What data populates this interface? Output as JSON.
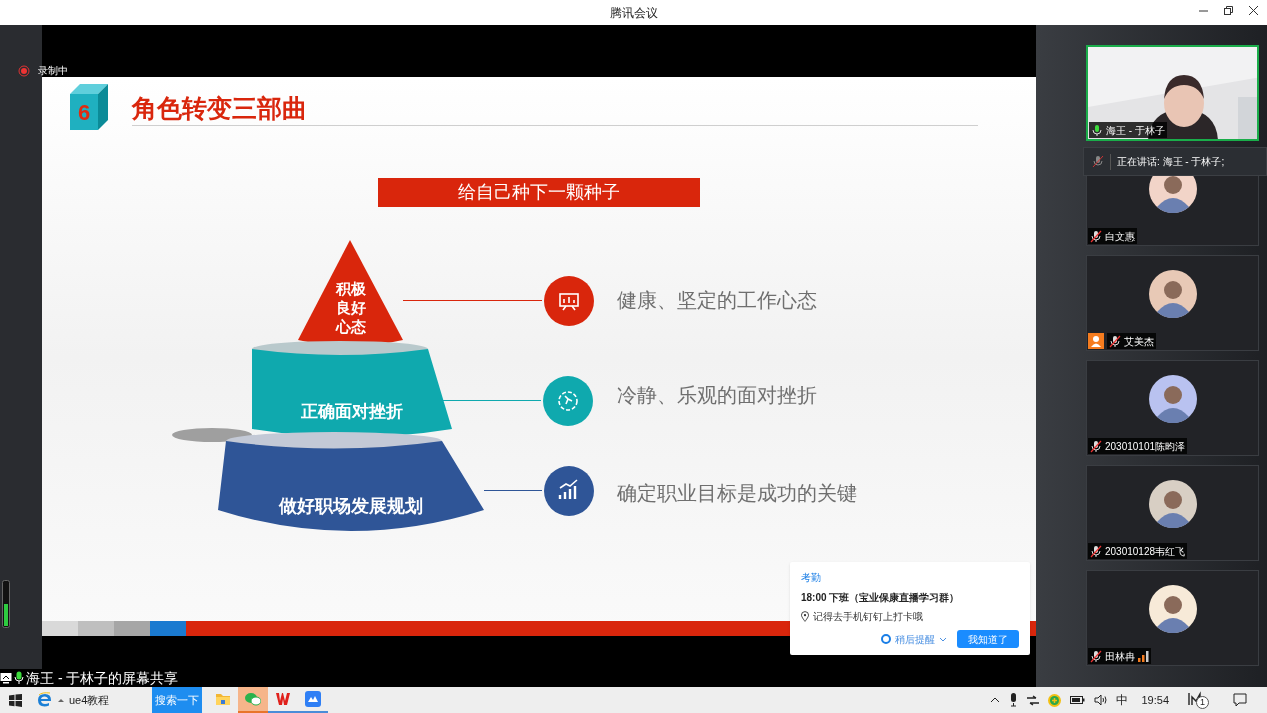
{
  "window": {
    "title": "腾讯会议"
  },
  "recording": {
    "label": "录制中"
  },
  "slide": {
    "number": "6",
    "title": "角色转变三部曲",
    "banner": "给自己种下一颗种子",
    "levels": [
      {
        "kind": "top",
        "label": "积极良好心态",
        "point": "健康、坚定的工作心态"
      },
      {
        "kind": "middle",
        "label": "正确面对挫折",
        "point": "冷静、乐观的面对挫折"
      },
      {
        "kind": "bottom",
        "label": "做好职场发展规划",
        "point": "确定职业目标是成功的关键"
      }
    ]
  },
  "participants": [
    {
      "kind": "video",
      "name": "海王 - 于林子",
      "muted": false,
      "speaking": true,
      "host_badge": false,
      "weak_signal": false
    },
    {
      "kind": "avatar",
      "name": "白文惠",
      "muted": true,
      "speaking": false,
      "host_badge": false,
      "weak_signal": false
    },
    {
      "kind": "avatar",
      "name": "艾美杰",
      "muted": true,
      "speaking": false,
      "host_badge": true,
      "weak_signal": false
    },
    {
      "kind": "avatar",
      "name": "203010101陈昀泽",
      "muted": true,
      "speaking": false,
      "host_badge": false,
      "weak_signal": false
    },
    {
      "kind": "avatar",
      "name": "203010128韦红飞",
      "muted": true,
      "speaking": false,
      "host_badge": false,
      "weak_signal": false
    },
    {
      "kind": "avatar",
      "name": "田林冉",
      "muted": true,
      "speaking": false,
      "host_badge": false,
      "weak_signal": true
    }
  ],
  "speaking_banner": {
    "text": "正在讲话: 海王 - 于林子;"
  },
  "notification": {
    "category": "考勤",
    "title": "18:00 下班（宝业保康直播学习群）",
    "location": "记得去手机钉钉上打卡哦",
    "snooze": "稍后提醒",
    "confirm": "我知道了"
  },
  "share_label": "海王 - 于林子的屏幕共享",
  "taskbar": {
    "items": [
      {
        "kind": "browser",
        "label": "ue4教程",
        "selected": false
      },
      {
        "kind": "search",
        "label": "搜索一下",
        "selected": false
      },
      {
        "kind": "folder",
        "selected": false
      },
      {
        "kind": "chat",
        "selected": true
      },
      {
        "kind": "office",
        "selected": false
      },
      {
        "kind": "cloud",
        "selected": false
      }
    ],
    "ime": "中",
    "time": "19:54",
    "notice_count": "1"
  }
}
